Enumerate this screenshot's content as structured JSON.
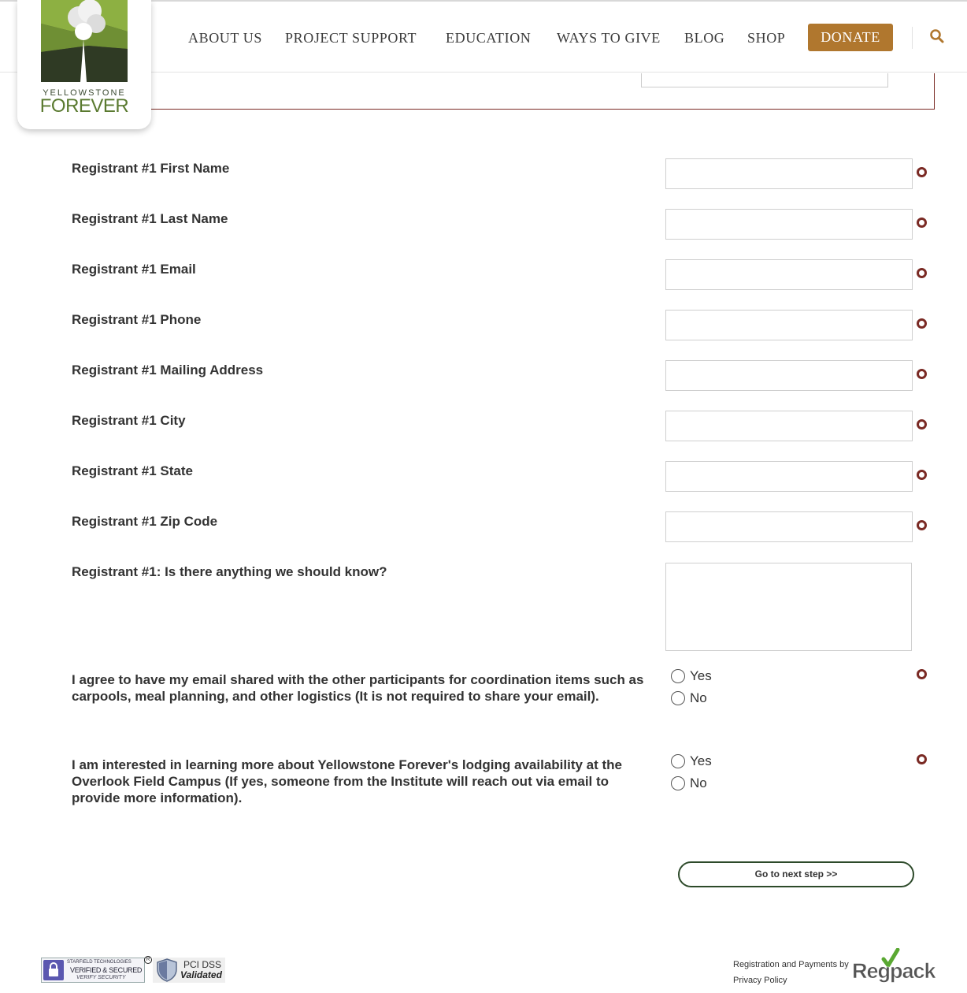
{
  "brand": {
    "logo_top": "YELLOWSTONE",
    "logo_main": "FOREVER"
  },
  "nav": {
    "items": [
      "ABOUT US",
      "PROJECT SUPPORT",
      "EDUCATION",
      "WAYS TO GIVE",
      "BLOG",
      "SHOP"
    ],
    "donate_label": "DONATE",
    "search_icon": "search-icon"
  },
  "colors": {
    "donate": "#b0772e",
    "required_marker": "#7a2a24",
    "button_border": "#2d4a2a"
  },
  "form": {
    "fields": [
      {
        "label": "Registrant #1 First Name",
        "value": ""
      },
      {
        "label": "Registrant #1 Last Name",
        "value": ""
      },
      {
        "label": "Registrant #1 Email",
        "value": ""
      },
      {
        "label": "Registrant #1 Phone",
        "value": ""
      },
      {
        "label": "Registrant #1 Mailing Address",
        "value": ""
      },
      {
        "label": "Registrant #1 City",
        "value": ""
      },
      {
        "label": "Registrant #1 State",
        "value": ""
      },
      {
        "label": "Registrant #1 Zip Code",
        "value": ""
      }
    ],
    "notes": {
      "label": "Registrant #1: Is there anything we should know?",
      "value": ""
    },
    "email_share": {
      "label": "I agree to have my email shared with the other participants for coordination items such as carpools, meal planning, and other logistics (It is not required to share your email).",
      "options": [
        "Yes",
        "No"
      ]
    },
    "lodging": {
      "label": "I am interested in learning more about Yellowstone Forever's lodging availability at the Overlook Field Campus (If yes, someone from the Institute will reach out via email to provide more information).",
      "options": [
        "Yes",
        "No"
      ]
    },
    "next_button": "Go to next step >>"
  },
  "footer": {
    "starfield_line1": "STARFIELD TECHNOLOGIES",
    "starfield_line2": "VERIFIED & SECURED",
    "starfield_line3": "VERIFY SECURITY",
    "registered_mark": "R",
    "pci_line1": "PCI DSS",
    "pci_line2": "Validated",
    "regpack_text": "Registration and Payments by",
    "regpack_logo": "Regpack",
    "privacy": "Privacy Policy"
  }
}
